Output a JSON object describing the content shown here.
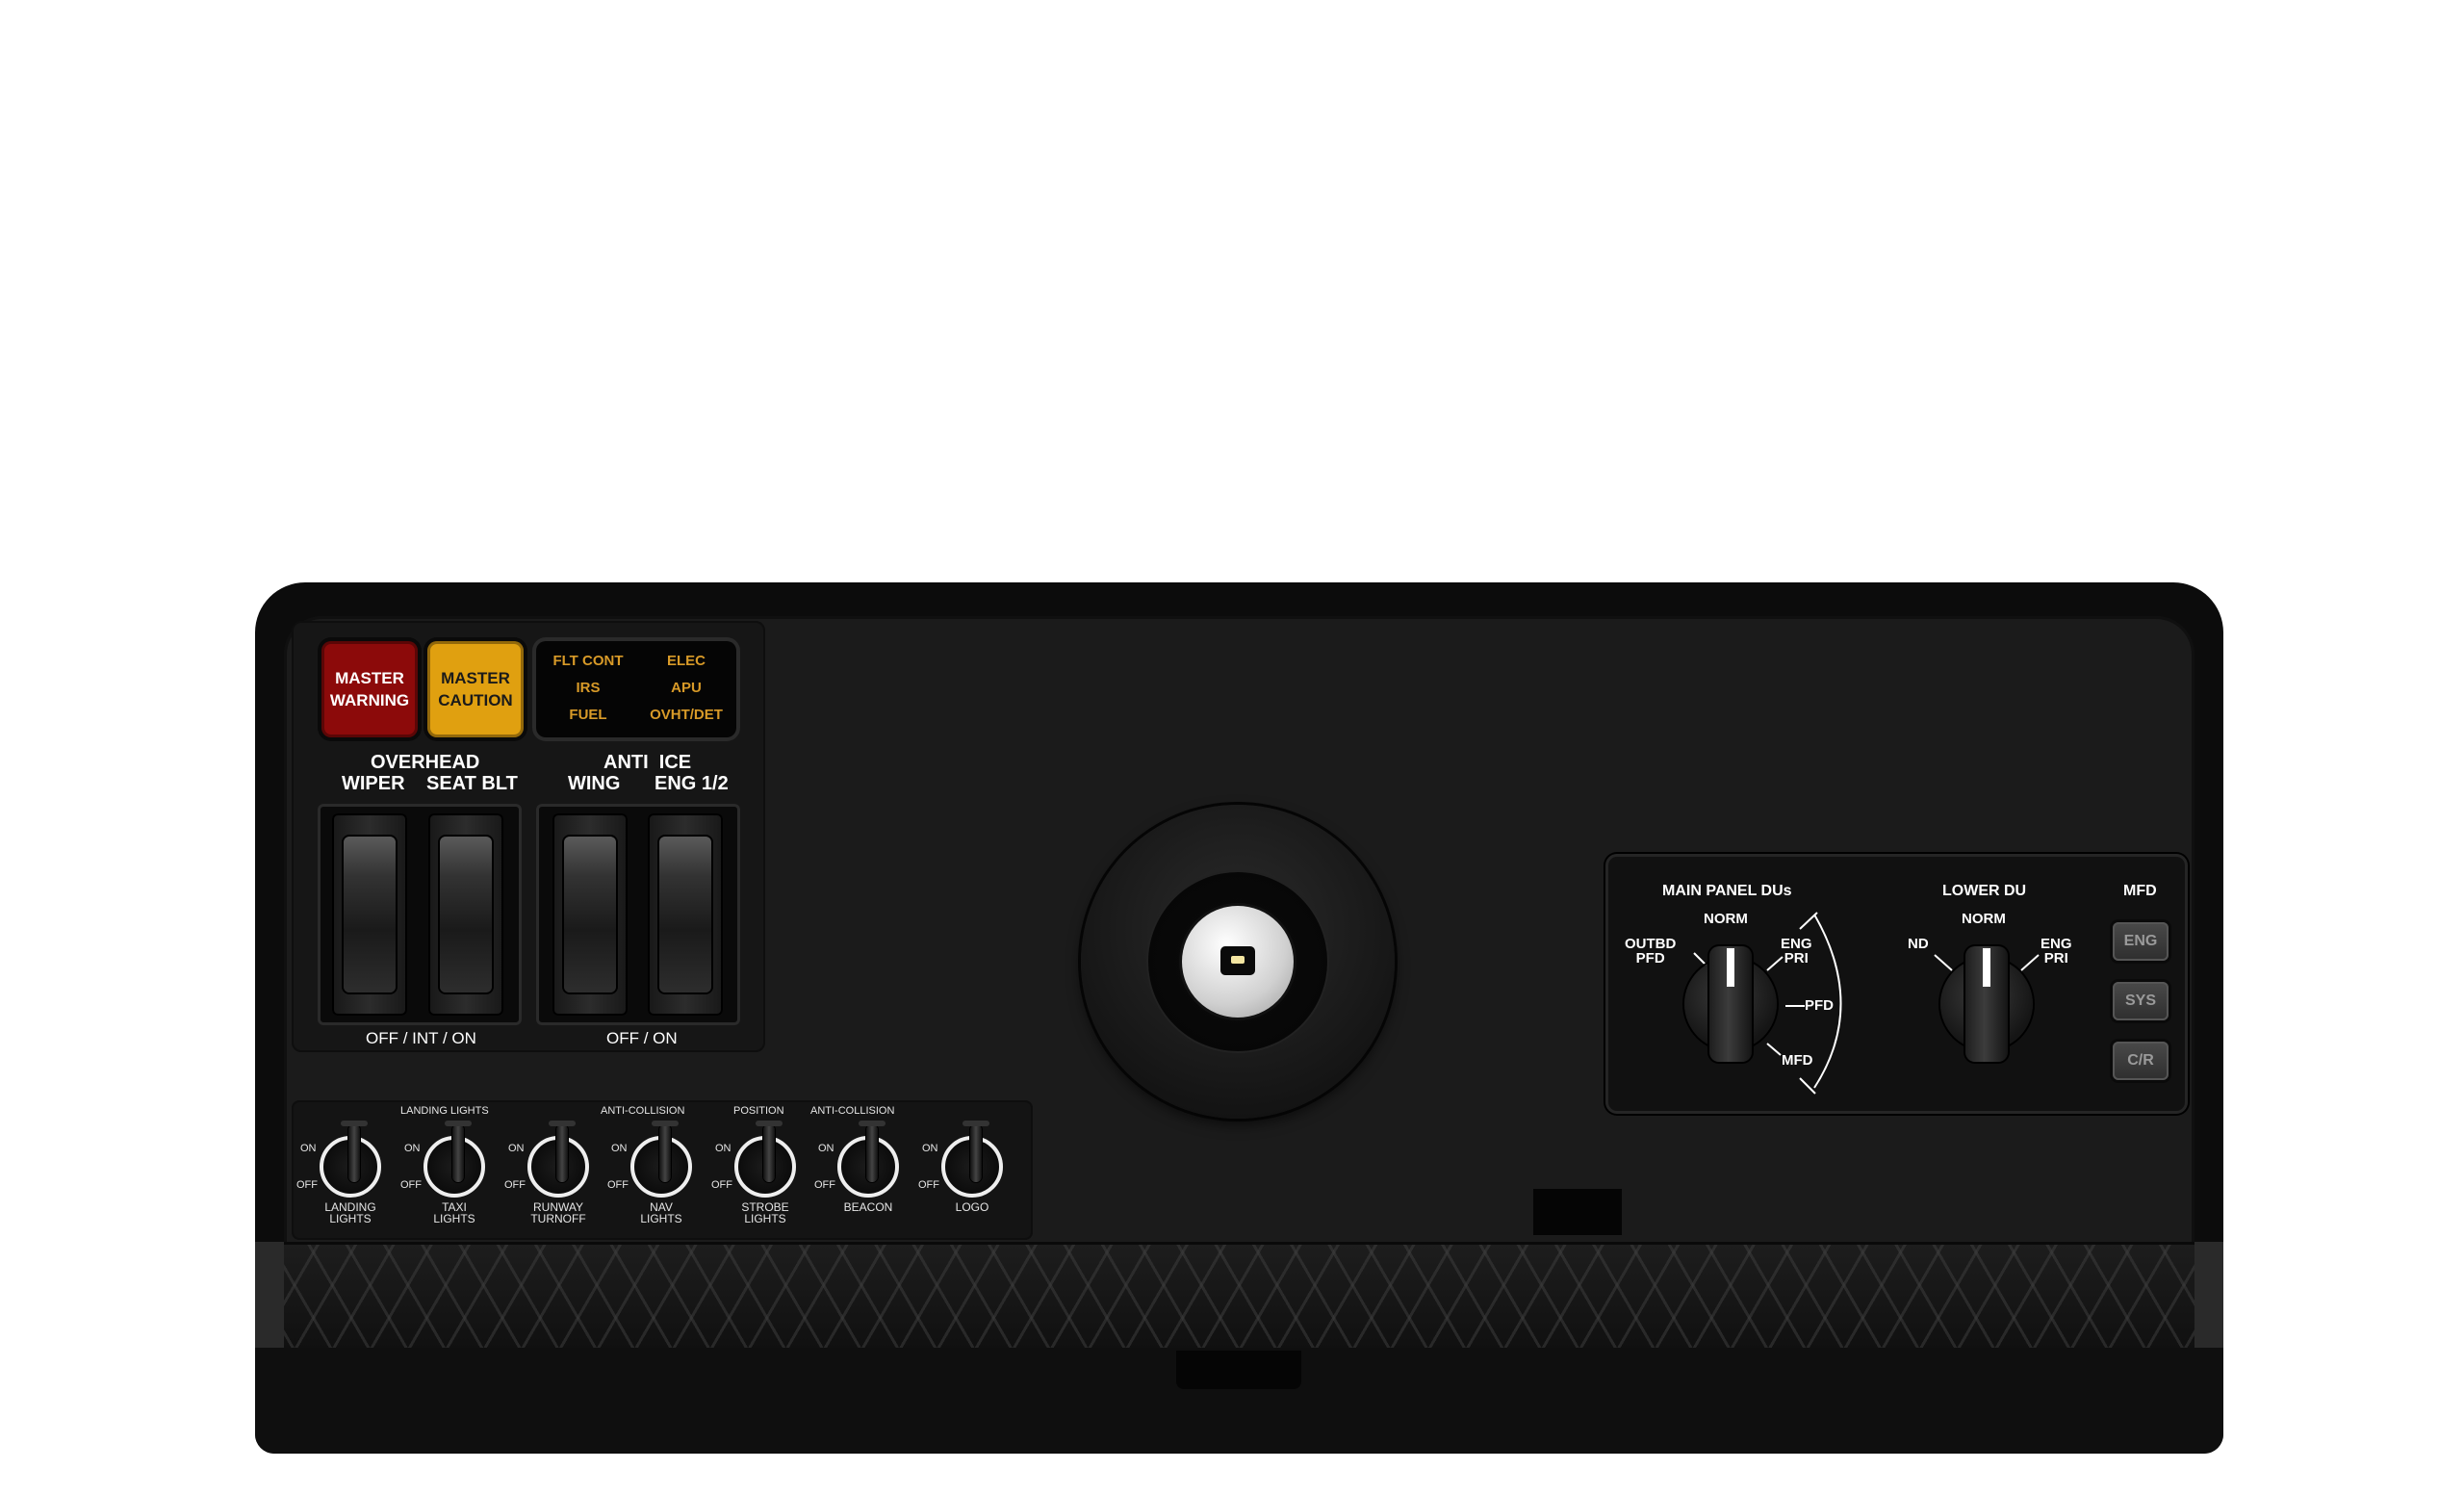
{
  "annunciators": {
    "master_warning": [
      "MASTER",
      "WARNING"
    ],
    "master_caution": [
      "MASTER",
      "CAUTION"
    ],
    "system": [
      "FLT CONT",
      "ELEC",
      "IRS",
      "APU",
      "FUEL",
      "OVHT/DET"
    ]
  },
  "overhead": {
    "title": "OVERHEAD",
    "wiper": "WIPER",
    "seat_blt": "SEAT BLT",
    "positions": "OFF / INT / ON"
  },
  "anti_ice": {
    "title": "ANTI  ICE",
    "wing": "WING",
    "eng": "ENG 1/2",
    "positions": "OFF / ON"
  },
  "lights": {
    "group_landing": "LANDING LIGHTS",
    "group_anticollision_1": "ANTI-COLLISION",
    "group_position": "POSITION",
    "group_anticollision_2": "ANTI-COLLISION",
    "on": "ON",
    "off": "OFF",
    "switches": [
      [
        "LANDING",
        "LIGHTS"
      ],
      [
        "TAXI",
        "LIGHTS"
      ],
      [
        "RUNWAY",
        "TURNOFF"
      ],
      [
        "NAV",
        "LIGHTS"
      ],
      [
        "STROBE",
        "LIGHTS"
      ],
      [
        "BEACON",
        ""
      ],
      [
        "LOGO",
        ""
      ]
    ]
  },
  "main_panel_dus": {
    "title": "MAIN PANEL DUs",
    "outbd": [
      "OUTBD",
      "PFD"
    ],
    "norm": "NORM",
    "eng_pri": [
      "ENG",
      "PRI"
    ],
    "pfd": "PFD",
    "mfd": "MFD"
  },
  "lower_du": {
    "title": "LOWER DU",
    "nd": "ND",
    "norm": "NORM",
    "eng_pri": [
      "ENG",
      "PRI"
    ]
  },
  "mfd": {
    "title": "MFD",
    "buttons": [
      "ENG",
      "SYS",
      "C/R"
    ]
  }
}
